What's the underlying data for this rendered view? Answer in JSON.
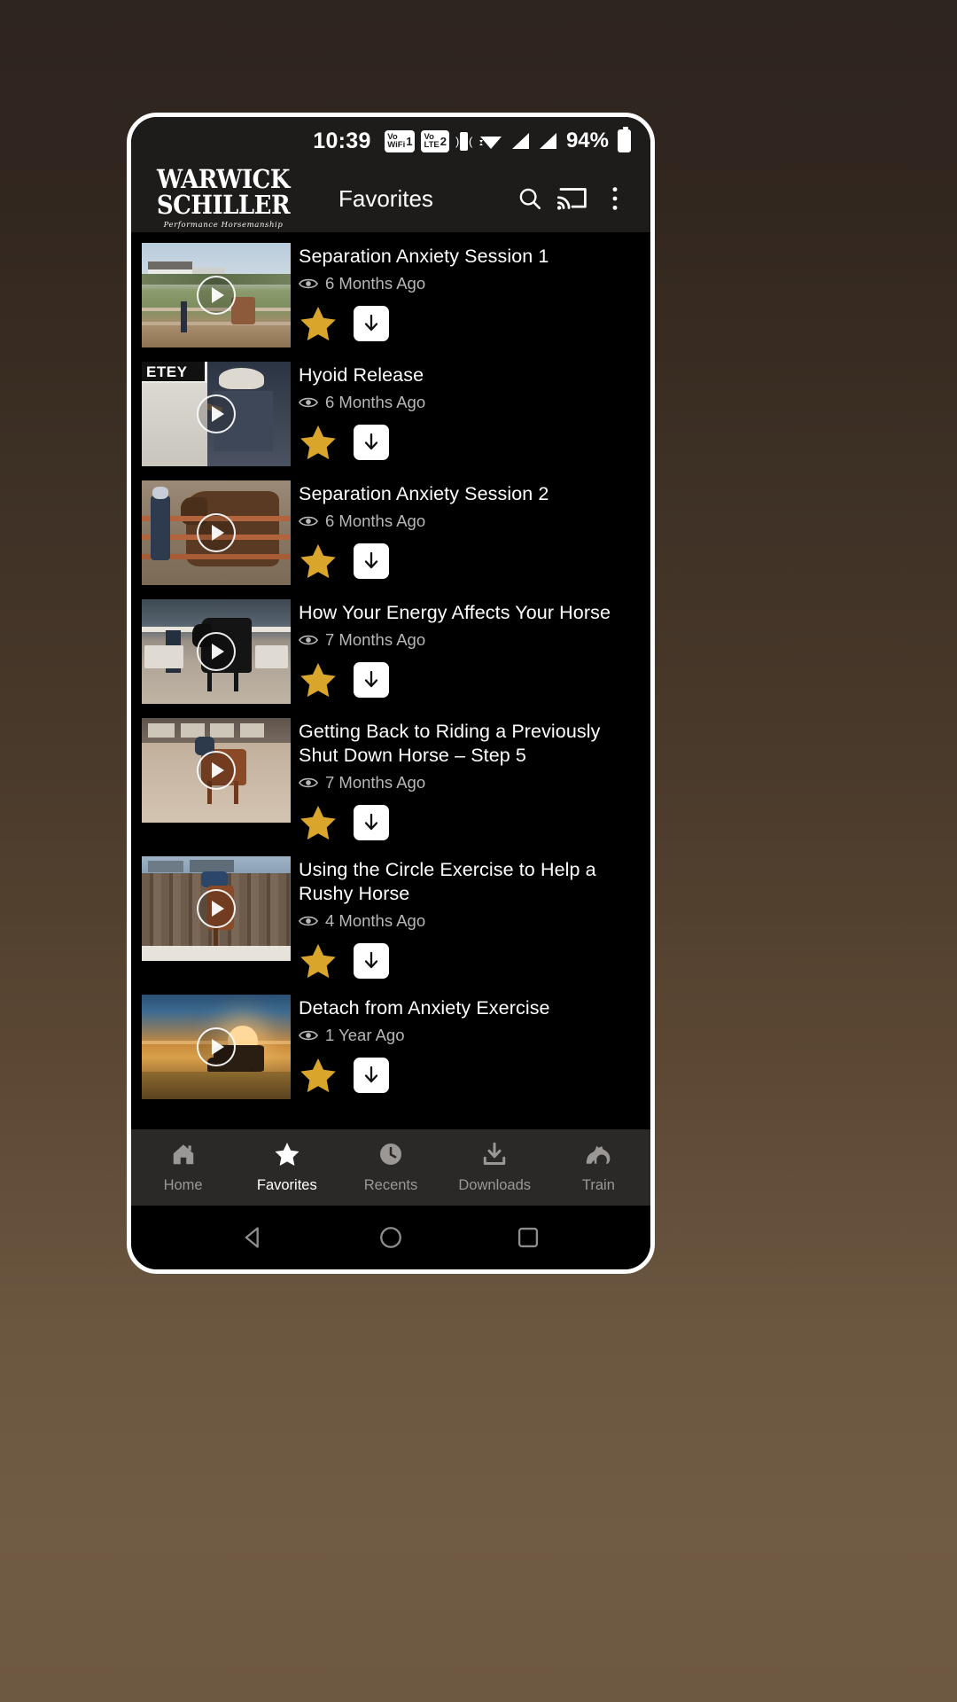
{
  "status_bar": {
    "time": "10:39",
    "vowifi_label_top": "Vo",
    "vowifi_label_bottom": "WiFi",
    "vowifi_sim": "1",
    "volte_label_top": "Vo",
    "volte_label_bottom": "LTE",
    "volte_sim": "2",
    "vibrate_icon": "vibrate-icon",
    "wifi_icon": "wifi-icon",
    "signal_icon_1": "signal-bars-icon",
    "signal_icon_2": "signal-bars-icon",
    "battery_percent": "94%",
    "battery_icon": "battery-full-icon"
  },
  "header": {
    "logo_line1": "WARWICK",
    "logo_line2": "SCHILLER",
    "logo_tagline": "Performance Horsemanship",
    "title": "Favorites",
    "search_icon": "search-icon",
    "cast_icon": "cast-icon",
    "overflow_icon": "more-vertical-icon"
  },
  "colors": {
    "star_gold": "#D9A52B",
    "header_bg": "#1e1c1b",
    "list_bg": "#000000",
    "nav_bg": "#2b2927",
    "nav_active": "#ffffff",
    "nav_inactive": "#9a9795",
    "meta_text": "#b7b7b7"
  },
  "videos": [
    {
      "title": "Separation Anxiety Session 1",
      "meta": "6 Months Ago",
      "eye_icon": "eye-icon",
      "play_icon": "play-icon",
      "favorite_icon": "star-filled-icon",
      "download_icon": "download-arrow-icon",
      "thumb": "farm-house-field"
    },
    {
      "title": "Hyoid Release",
      "meta": "6 Months Ago",
      "eye_icon": "eye-icon",
      "play_icon": "play-icon",
      "favorite_icon": "star-filled-icon",
      "download_icon": "download-arrow-icon",
      "thumb": "petey-banner-rider"
    },
    {
      "title": "Separation Anxiety Session 2",
      "meta": "6 Months Ago",
      "eye_icon": "eye-icon",
      "play_icon": "play-icon",
      "favorite_icon": "star-filled-icon",
      "download_icon": "download-arrow-icon",
      "thumb": "horse-at-fence"
    },
    {
      "title": "How Your Energy Affects Your Horse",
      "meta": "7 Months Ago",
      "eye_icon": "eye-icon",
      "play_icon": "play-icon",
      "favorite_icon": "star-filled-icon",
      "download_icon": "download-arrow-icon",
      "thumb": "arena-black-horse"
    },
    {
      "title": "Getting Back to Riding a Previously Shut Down Horse – Step 5",
      "meta": "7 Months Ago",
      "eye_icon": "eye-icon",
      "play_icon": "play-icon",
      "favorite_icon": "star-filled-icon",
      "download_icon": "download-arrow-icon",
      "thumb": "indoor-arena-rider"
    },
    {
      "title": "Using the Circle Exercise to Help a Rushy Horse",
      "meta": "4 Months Ago",
      "eye_icon": "eye-icon",
      "play_icon": "play-icon",
      "favorite_icon": "star-filled-icon",
      "download_icon": "download-arrow-icon",
      "thumb": "wooden-fence-rider"
    },
    {
      "title": "Detach from Anxiety Exercise",
      "meta": "1 Year Ago",
      "eye_icon": "eye-icon",
      "play_icon": "play-icon",
      "favorite_icon": "star-filled-icon",
      "download_icon": "download-arrow-icon",
      "thumb": "sunset-horse-grazing"
    }
  ],
  "bottom_nav": [
    {
      "label": "Home",
      "icon": "home-icon",
      "active": false
    },
    {
      "label": "Favorites",
      "icon": "star-icon",
      "active": true
    },
    {
      "label": "Recents",
      "icon": "clock-icon",
      "active": false
    },
    {
      "label": "Downloads",
      "icon": "download-icon",
      "active": false
    },
    {
      "label": "Train",
      "icon": "horse-icon",
      "active": false
    }
  ],
  "system_nav": {
    "back": "back-triangle-icon",
    "home": "home-circle-icon",
    "recents": "recents-square-icon"
  }
}
